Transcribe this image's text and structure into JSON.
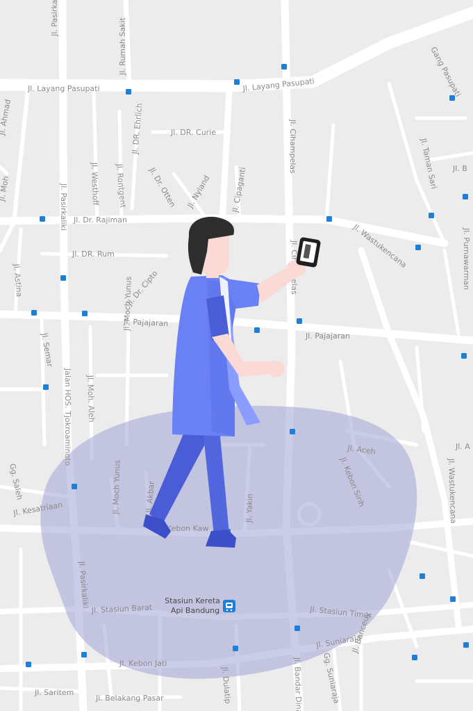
{
  "map": {
    "streets": {
      "layang_pasupati_w": "Jl. Layang Pasupati",
      "layang_pasupati_e": "Jl. Layang Pasupati",
      "pasirkaliki_top": "Jl. Pasirkaliki",
      "rumah_sakit": "Jl. Rumah Sakit",
      "gang_pasupati": "Gang Pasupati",
      "dr_ehrlich": "Jl. DR. Ehrlich",
      "dr_curie": "Jl. DR. Curie",
      "cihampelas_n": "Jl. Cihampelas",
      "taman_sari": "Jl. Taman Sari",
      "moh": "Jl. Moh",
      "ahmad": "Jl. Ahmad",
      "westhoff": "Jl. Westhoff",
      "rontgent": "Jl. Rontgent",
      "dr_otten": "Jl. Dr. Otten",
      "nyland": "Jl. Nyland",
      "cipaganti": "Jl. Cipaganti",
      "pasirkaliki_mid": "Jl. Pasirkaliki",
      "dr_rajiman": "Jl. Dr. Rajiman",
      "wastukencana_n": "Jl. Wastukencana",
      "dr_rum": "Jl. DR. Rum",
      "purnawarman": "Jl. Purnawarman",
      "astina": "Jl. Astina",
      "dr_cipto": "Jl. Dr. Cipto",
      "cihampelas_s": "Jl. Cihampelas",
      "pajajaran_w": "Jl. Pajajaran",
      "pajajaran_e": "Jl. Pajajaran",
      "semar": "Jl. Semar",
      "hos_tjokroaminoto": "Jalan HOS. Tjokroaminoto",
      "moch_yunus_n": "Jl. Moch Yunus",
      "moh_aleh": "Jl. Moh. Aleh",
      "aceh": "Jl. Aceh",
      "kebon_sirih": "Jl. Kebon Sirih",
      "wastukencana_s": "Jl. Wastukencana",
      "gg_saleh": "Gg. Saleh",
      "kesatriaan": "Jl. Kesatriaan",
      "moch_yunus_s": "Jl. Moch Yunus",
      "akbar": "Jl. Akbar",
      "yakin": "Jl. Yakin",
      "kebon_kawung": "Kebon Kaw",
      "pasirkaliki_s": "Jl. Pasirkaliki",
      "stasiun_barat": "Jl. Stasiun Barat",
      "stasiun_timur": "Jl. Stasiun Timur",
      "suniaraja": "Jl. Suniaraja",
      "gg_suniaraja": "Gg. Suniaraja",
      "banceuy": "Jl. Banceuy",
      "kebon_jati": "Jl. Kebon Jati",
      "saritem": "Jl. Saritem",
      "belakang_pasar": "Jl. Belakang Pasar",
      "dulatip": "Jl. Dulatip",
      "bandar_dinata": "Jl. Bandar Dinata",
      "right_edge_a": "Jl. A",
      "right_edge_b": "Jl. B"
    },
    "station": {
      "name_line1": "Stasiun Kereta",
      "name_line2": "Api Bandung"
    }
  },
  "colors": {
    "map_background": "#ececec",
    "road": "#ffffff",
    "area_fill": "#a9acd8",
    "transit_icon": "#1e7fd6",
    "person_shirt": "#6a80f5",
    "person_pants": "#4a5cd6",
    "person_hair": "#2d2d2d",
    "person_skin": "#fbd9d4"
  }
}
